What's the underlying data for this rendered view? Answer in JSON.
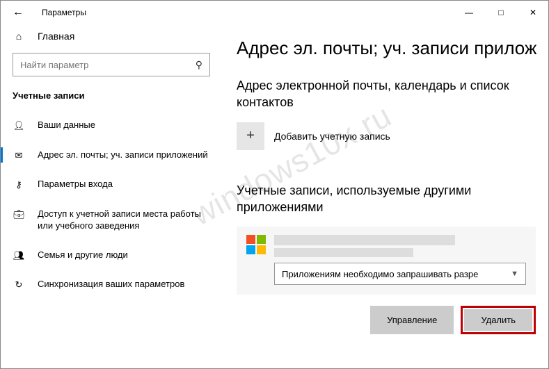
{
  "window": {
    "title": "Параметры"
  },
  "nav": {
    "home": "Главная",
    "search_placeholder": "Найти параметр",
    "section": "Учетные записи",
    "items": [
      {
        "icon": "person",
        "label": "Ваши данные"
      },
      {
        "icon": "mail",
        "label": "Адрес эл. почты; уч. записи приложений"
      },
      {
        "icon": "key",
        "label": "Параметры входа"
      },
      {
        "icon": "briefcase",
        "label": "Доступ к учетной записи места работы или учебного заведения"
      },
      {
        "icon": "family",
        "label": "Семья и другие люди"
      },
      {
        "icon": "sync",
        "label": "Синхронизация ваших параметров"
      }
    ]
  },
  "main": {
    "heading": "Адрес эл. почты; уч. записи прилож",
    "sub1": "Адрес электронной почты, календарь и список контактов",
    "add_label": "Добавить учетную запись",
    "sub2": "Учетные записи, используемые другими приложениями",
    "permission_option": "Приложениям необходимо запрашивать разре",
    "manage": "Управление",
    "delete": "Удалить"
  },
  "watermark": "windows10x.ru"
}
